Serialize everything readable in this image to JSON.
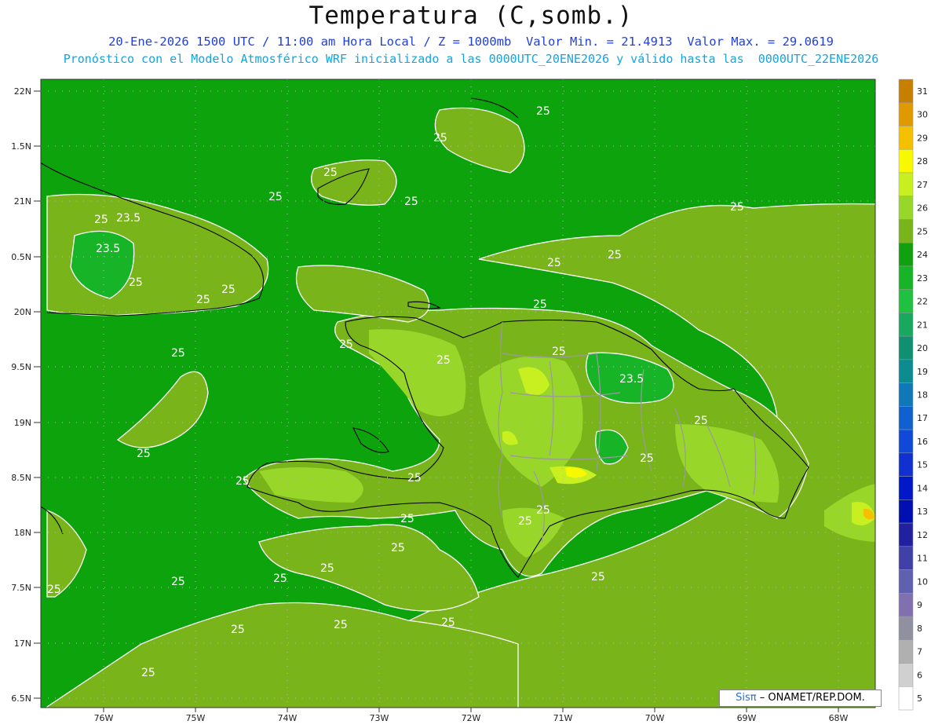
{
  "header": {
    "title": "Temperatura (C,somb.)",
    "line1": "20-Ene-2026 1500 UTC / 11:00 am Hora Local / Z = 1000mb  Valor Min. = 21.4913  Valor Max. = 29.0619",
    "line2": "Pronóstico con el Modelo Atmosférico WRF inicializado a las 0000UTC_20ENE2026 y válido hasta las  0000UTC_22ENE2026"
  },
  "axes": {
    "lat_labels": [
      "22N",
      "1.5N",
      "21N",
      "0.5N",
      "20N",
      "9.5N",
      "19N",
      "8.5N",
      "18N",
      "7.5N",
      "17N",
      "6.5N"
    ],
    "lon_labels": [
      "76W",
      "75W",
      "74W",
      "73W",
      "72W",
      "71W",
      "70W",
      "69W",
      "68W"
    ]
  },
  "legend": {
    "levels": [
      "31",
      "30",
      "29",
      "28",
      "27",
      "26",
      "25",
      "24",
      "23",
      "22",
      "21",
      "20",
      "19",
      "18",
      "17",
      "16",
      "15",
      "14",
      "13",
      "12",
      "11",
      "10",
      "9",
      "8",
      "7",
      "6",
      "5"
    ],
    "colors": [
      "#c77f00",
      "#e09a00",
      "#f5c000",
      "#f8f800",
      "#c8f020",
      "#98d62a",
      "#78b41a",
      "#10a010",
      "#18b428",
      "#20c040",
      "#18a860",
      "#109070",
      "#0c8c90",
      "#1078b8",
      "#1060d0",
      "#1048d8",
      "#1030d0",
      "#0018c8",
      "#0010b0",
      "#2020a0",
      "#4040a8",
      "#6060b0",
      "#8070b0",
      "#9090a0",
      "#b0b0b0",
      "#d0d0d0",
      "#ffffff"
    ]
  },
  "contour_labels": [
    "25",
    "23.5"
  ],
  "credit": {
    "brand": "Sisπ",
    "text": "– ONAMET/REP.DOM."
  }
}
